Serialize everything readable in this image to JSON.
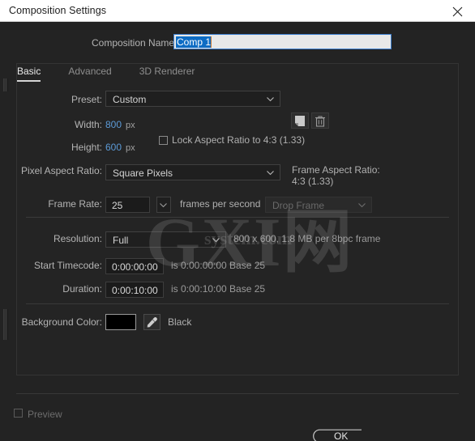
{
  "window": {
    "title": "Composition Settings",
    "close_icon": "close-icon"
  },
  "composition_name": {
    "label": "Composition Name:",
    "value": "Comp 1",
    "placeholder": "Comp 1"
  },
  "tabs": [
    {
      "label": "Basic",
      "active": true
    },
    {
      "label": "Advanced",
      "active": false
    },
    {
      "label": "3D Renderer",
      "active": false
    }
  ],
  "basic": {
    "preset": {
      "label": "Preset:",
      "value": "Custom",
      "save_icon": "save-preset-icon",
      "delete_icon": "trash-icon"
    },
    "width": {
      "label": "Width:",
      "value": "800",
      "unit": "px"
    },
    "height": {
      "label": "Height:",
      "value": "600",
      "unit": "px"
    },
    "lock_aspect": {
      "label": "Lock Aspect Ratio to 4:3 (1.33)",
      "checked": false
    },
    "pixel_aspect_ratio": {
      "label": "Pixel Aspect Ratio:",
      "value": "Square Pixels"
    },
    "frame_aspect_ratio": {
      "label": "Frame Aspect Ratio:",
      "value": "4:3 (1.33)"
    },
    "frame_rate": {
      "label": "Frame Rate:",
      "value": "25",
      "units_label": "frames per second",
      "drop_frame": "Drop Frame"
    },
    "resolution": {
      "label": "Resolution:",
      "value": "Full",
      "info": "800 x 600, 1.8 MB per 8bpc frame"
    },
    "start_timecode": {
      "label": "Start Timecode:",
      "value": "0:00:00:00",
      "info": "is 0:00:00:00  Base 25"
    },
    "duration": {
      "label": "Duration:",
      "value": "0:00:10:00",
      "info": "is 0:00:10:00  Base 25"
    },
    "background_color": {
      "label": "Background Color:",
      "swatch_hex": "#000000",
      "name": "Black",
      "eyedropper_icon": "eyedropper-icon"
    }
  },
  "footer": {
    "preview": {
      "label": "Preview",
      "checked": false,
      "disabled": true
    },
    "ok_label": "OK"
  },
  "watermark": {
    "main": "GXI网",
    "sub": "system.com"
  },
  "colors": {
    "dialog_bg": "#232323",
    "titlebar_bg": "#ffffff",
    "hot_text": "#5c9ad6",
    "selection_blue": "#0d6cc4",
    "label": "#b4b4b4"
  }
}
